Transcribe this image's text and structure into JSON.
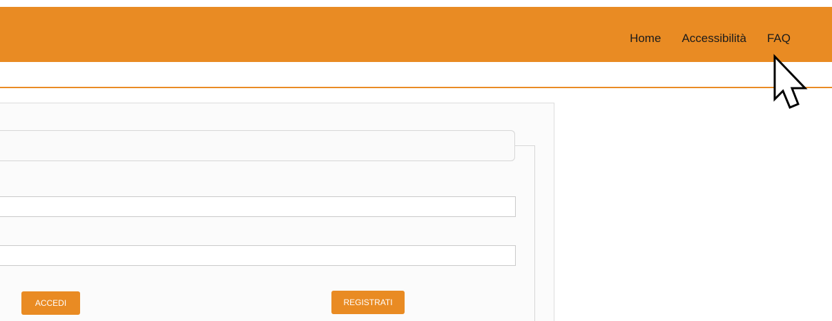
{
  "header": {
    "nav": [
      {
        "label": "Home"
      },
      {
        "label": "Accessibilità"
      },
      {
        "label": "FAQ"
      }
    ]
  },
  "form": {
    "username_value": "",
    "password_value": "",
    "login_label": "ACCEDI",
    "register_label": "REGISTRATI"
  },
  "colors": {
    "accent": "#e98b23",
    "panel_bg": "#fbfbfb",
    "border": "#d6d6d6"
  },
  "icons": {
    "cursor": "mouse-pointer-icon"
  }
}
